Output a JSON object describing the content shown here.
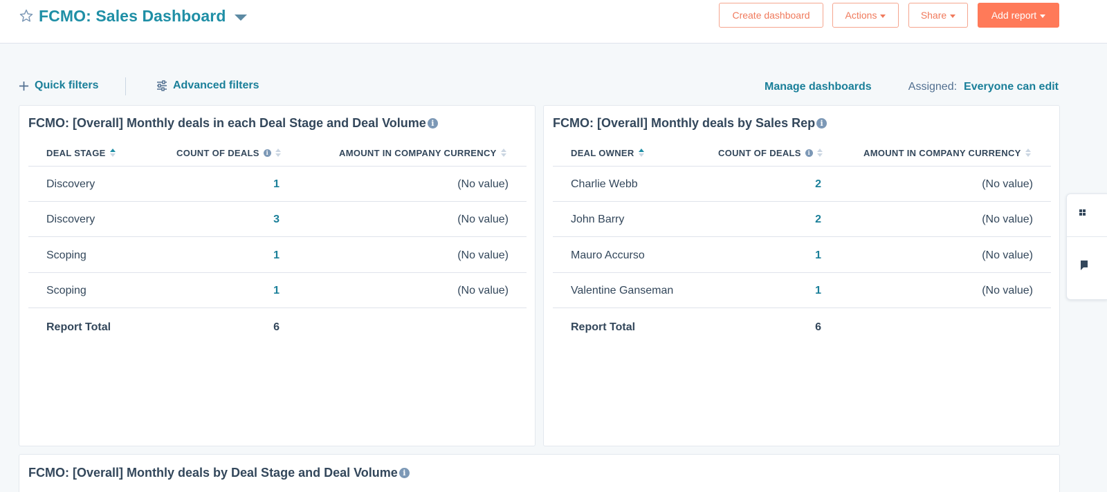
{
  "header": {
    "title": "FCMO: Sales Dashboard",
    "buttons": {
      "create": "Create dashboard",
      "actions": "Actions",
      "share": "Share",
      "add_report": "Add report"
    }
  },
  "filters": {
    "quick": "Quick filters",
    "advanced": "Advanced filters",
    "manage": "Manage dashboards",
    "assigned_label": "Assigned:",
    "assigned_value": "Everyone can edit"
  },
  "cards": [
    {
      "title": "FCMO: [Overall] Monthly deals in each Deal Stage and Deal Volume",
      "columns": [
        "DEAL STAGE",
        "COUNT OF DEALS",
        "AMOUNT IN COMPANY CURRENCY"
      ],
      "rows": [
        {
          "name": "Discovery",
          "count": "1",
          "amount": "(No value)"
        },
        {
          "name": "Discovery",
          "count": "3",
          "amount": "(No value)"
        },
        {
          "name": "Scoping",
          "count": "1",
          "amount": "(No value)"
        },
        {
          "name": "Scoping",
          "count": "1",
          "amount": "(No value)"
        }
      ],
      "total_label": "Report Total",
      "total_value": "6"
    },
    {
      "title": "FCMO: [Overall] Monthly deals by Sales Rep",
      "columns": [
        "DEAL OWNER",
        "COUNT OF DEALS",
        "AMOUNT IN COMPANY CURRENCY"
      ],
      "rows": [
        {
          "name": "Charlie Webb",
          "count": "2",
          "amount": "(No value)"
        },
        {
          "name": "John Barry",
          "count": "2",
          "amount": "(No value)"
        },
        {
          "name": "Mauro Accurso",
          "count": "1",
          "amount": "(No value)"
        },
        {
          "name": "Valentine Ganseman",
          "count": "1",
          "amount": "(No value)"
        }
      ],
      "total_label": "Report Total",
      "total_value": "6"
    },
    {
      "title": "FCMO: [Overall] Monthly deals by Deal Stage and Deal Volume"
    }
  ],
  "icons": {
    "info": "i"
  },
  "colors": {
    "accent": "#1f8fa6",
    "link": "#1a7f99",
    "primary_button": "#ff7a59",
    "text": "#33475b",
    "background": "#f5f8fa"
  }
}
